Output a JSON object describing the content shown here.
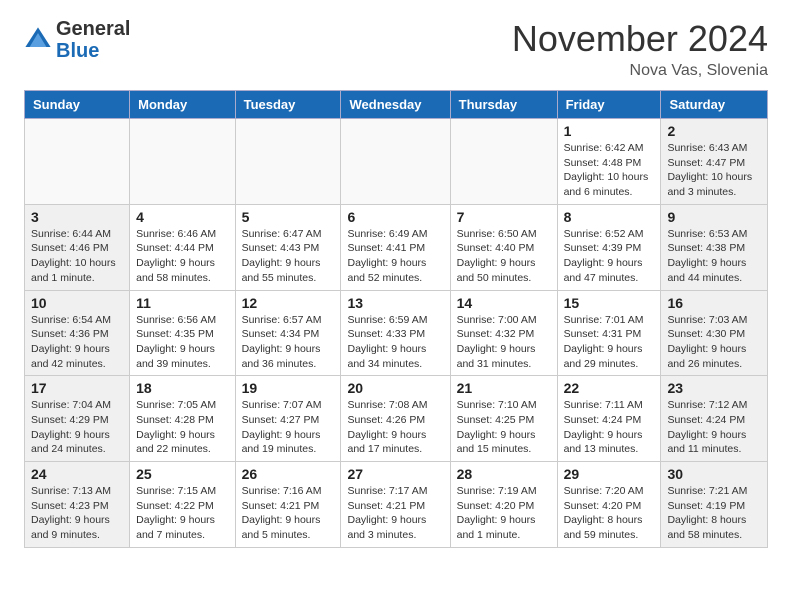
{
  "header": {
    "logo_general": "General",
    "logo_blue": "Blue",
    "month_title": "November 2024",
    "location": "Nova Vas, Slovenia"
  },
  "weekdays": [
    "Sunday",
    "Monday",
    "Tuesday",
    "Wednesday",
    "Thursday",
    "Friday",
    "Saturday"
  ],
  "weeks": [
    [
      {
        "day": "",
        "info": "",
        "empty": true
      },
      {
        "day": "",
        "info": "",
        "empty": true
      },
      {
        "day": "",
        "info": "",
        "empty": true
      },
      {
        "day": "",
        "info": "",
        "empty": true
      },
      {
        "day": "",
        "info": "",
        "empty": true
      },
      {
        "day": "1",
        "info": "Sunrise: 6:42 AM\nSunset: 4:48 PM\nDaylight: 10 hours and 6 minutes.",
        "empty": false
      },
      {
        "day": "2",
        "info": "Sunrise: 6:43 AM\nSunset: 4:47 PM\nDaylight: 10 hours and 3 minutes.",
        "empty": false
      }
    ],
    [
      {
        "day": "3",
        "info": "Sunrise: 6:44 AM\nSunset: 4:46 PM\nDaylight: 10 hours and 1 minute.",
        "empty": false
      },
      {
        "day": "4",
        "info": "Sunrise: 6:46 AM\nSunset: 4:44 PM\nDaylight: 9 hours and 58 minutes.",
        "empty": false
      },
      {
        "day": "5",
        "info": "Sunrise: 6:47 AM\nSunset: 4:43 PM\nDaylight: 9 hours and 55 minutes.",
        "empty": false
      },
      {
        "day": "6",
        "info": "Sunrise: 6:49 AM\nSunset: 4:41 PM\nDaylight: 9 hours and 52 minutes.",
        "empty": false
      },
      {
        "day": "7",
        "info": "Sunrise: 6:50 AM\nSunset: 4:40 PM\nDaylight: 9 hours and 50 minutes.",
        "empty": false
      },
      {
        "day": "8",
        "info": "Sunrise: 6:52 AM\nSunset: 4:39 PM\nDaylight: 9 hours and 47 minutes.",
        "empty": false
      },
      {
        "day": "9",
        "info": "Sunrise: 6:53 AM\nSunset: 4:38 PM\nDaylight: 9 hours and 44 minutes.",
        "empty": false
      }
    ],
    [
      {
        "day": "10",
        "info": "Sunrise: 6:54 AM\nSunset: 4:36 PM\nDaylight: 9 hours and 42 minutes.",
        "empty": false
      },
      {
        "day": "11",
        "info": "Sunrise: 6:56 AM\nSunset: 4:35 PM\nDaylight: 9 hours and 39 minutes.",
        "empty": false
      },
      {
        "day": "12",
        "info": "Sunrise: 6:57 AM\nSunset: 4:34 PM\nDaylight: 9 hours and 36 minutes.",
        "empty": false
      },
      {
        "day": "13",
        "info": "Sunrise: 6:59 AM\nSunset: 4:33 PM\nDaylight: 9 hours and 34 minutes.",
        "empty": false
      },
      {
        "day": "14",
        "info": "Sunrise: 7:00 AM\nSunset: 4:32 PM\nDaylight: 9 hours and 31 minutes.",
        "empty": false
      },
      {
        "day": "15",
        "info": "Sunrise: 7:01 AM\nSunset: 4:31 PM\nDaylight: 9 hours and 29 minutes.",
        "empty": false
      },
      {
        "day": "16",
        "info": "Sunrise: 7:03 AM\nSunset: 4:30 PM\nDaylight: 9 hours and 26 minutes.",
        "empty": false
      }
    ],
    [
      {
        "day": "17",
        "info": "Sunrise: 7:04 AM\nSunset: 4:29 PM\nDaylight: 9 hours and 24 minutes.",
        "empty": false
      },
      {
        "day": "18",
        "info": "Sunrise: 7:05 AM\nSunset: 4:28 PM\nDaylight: 9 hours and 22 minutes.",
        "empty": false
      },
      {
        "day": "19",
        "info": "Sunrise: 7:07 AM\nSunset: 4:27 PM\nDaylight: 9 hours and 19 minutes.",
        "empty": false
      },
      {
        "day": "20",
        "info": "Sunrise: 7:08 AM\nSunset: 4:26 PM\nDaylight: 9 hours and 17 minutes.",
        "empty": false
      },
      {
        "day": "21",
        "info": "Sunrise: 7:10 AM\nSunset: 4:25 PM\nDaylight: 9 hours and 15 minutes.",
        "empty": false
      },
      {
        "day": "22",
        "info": "Sunrise: 7:11 AM\nSunset: 4:24 PM\nDaylight: 9 hours and 13 minutes.",
        "empty": false
      },
      {
        "day": "23",
        "info": "Sunrise: 7:12 AM\nSunset: 4:24 PM\nDaylight: 9 hours and 11 minutes.",
        "empty": false
      }
    ],
    [
      {
        "day": "24",
        "info": "Sunrise: 7:13 AM\nSunset: 4:23 PM\nDaylight: 9 hours and 9 minutes.",
        "empty": false
      },
      {
        "day": "25",
        "info": "Sunrise: 7:15 AM\nSunset: 4:22 PM\nDaylight: 9 hours and 7 minutes.",
        "empty": false
      },
      {
        "day": "26",
        "info": "Sunrise: 7:16 AM\nSunset: 4:21 PM\nDaylight: 9 hours and 5 minutes.",
        "empty": false
      },
      {
        "day": "27",
        "info": "Sunrise: 7:17 AM\nSunset: 4:21 PM\nDaylight: 9 hours and 3 minutes.",
        "empty": false
      },
      {
        "day": "28",
        "info": "Sunrise: 7:19 AM\nSunset: 4:20 PM\nDaylight: 9 hours and 1 minute.",
        "empty": false
      },
      {
        "day": "29",
        "info": "Sunrise: 7:20 AM\nSunset: 4:20 PM\nDaylight: 8 hours and 59 minutes.",
        "empty": false
      },
      {
        "day": "30",
        "info": "Sunrise: 7:21 AM\nSunset: 4:19 PM\nDaylight: 8 hours and 58 minutes.",
        "empty": false
      }
    ]
  ]
}
